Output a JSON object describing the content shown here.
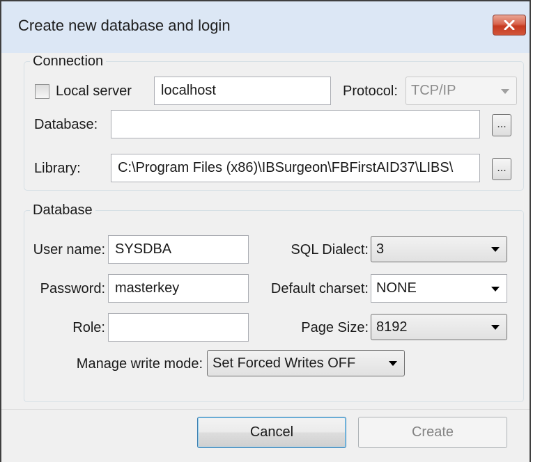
{
  "window": {
    "title": "Create new database and login"
  },
  "connection": {
    "legend": "Connection",
    "local_server_label": "Local server",
    "local_server_checked": false,
    "server_value": "localhost",
    "protocol_label": "Protocol:",
    "protocol_value": "TCP/IP",
    "database_label": "Database:",
    "database_value": "",
    "library_label": "Library:",
    "library_value": "C:\\Program Files (x86)\\IBSurgeon\\FBFirstAID37\\LIBS\\",
    "browse_label": "..."
  },
  "database": {
    "legend": "Database",
    "user_label": "User name:",
    "user_value": "SYSDBA",
    "password_label": "Password:",
    "password_value": "masterkey",
    "role_label": "Role:",
    "role_value": "",
    "dialect_label": "SQL Dialect:",
    "dialect_value": "3",
    "charset_label": "Default charset:",
    "charset_value": "NONE",
    "pagesize_label": "Page Size:",
    "pagesize_value": "8192",
    "writemode_label": "Manage write mode:",
    "writemode_value": "Set Forced Writes OFF"
  },
  "buttons": {
    "cancel": "Cancel",
    "create": "Create"
  },
  "colors": {
    "titlebar": "#dce7f5",
    "close_button": "#c63a1f",
    "default_button_border": "#3c7fb1"
  }
}
